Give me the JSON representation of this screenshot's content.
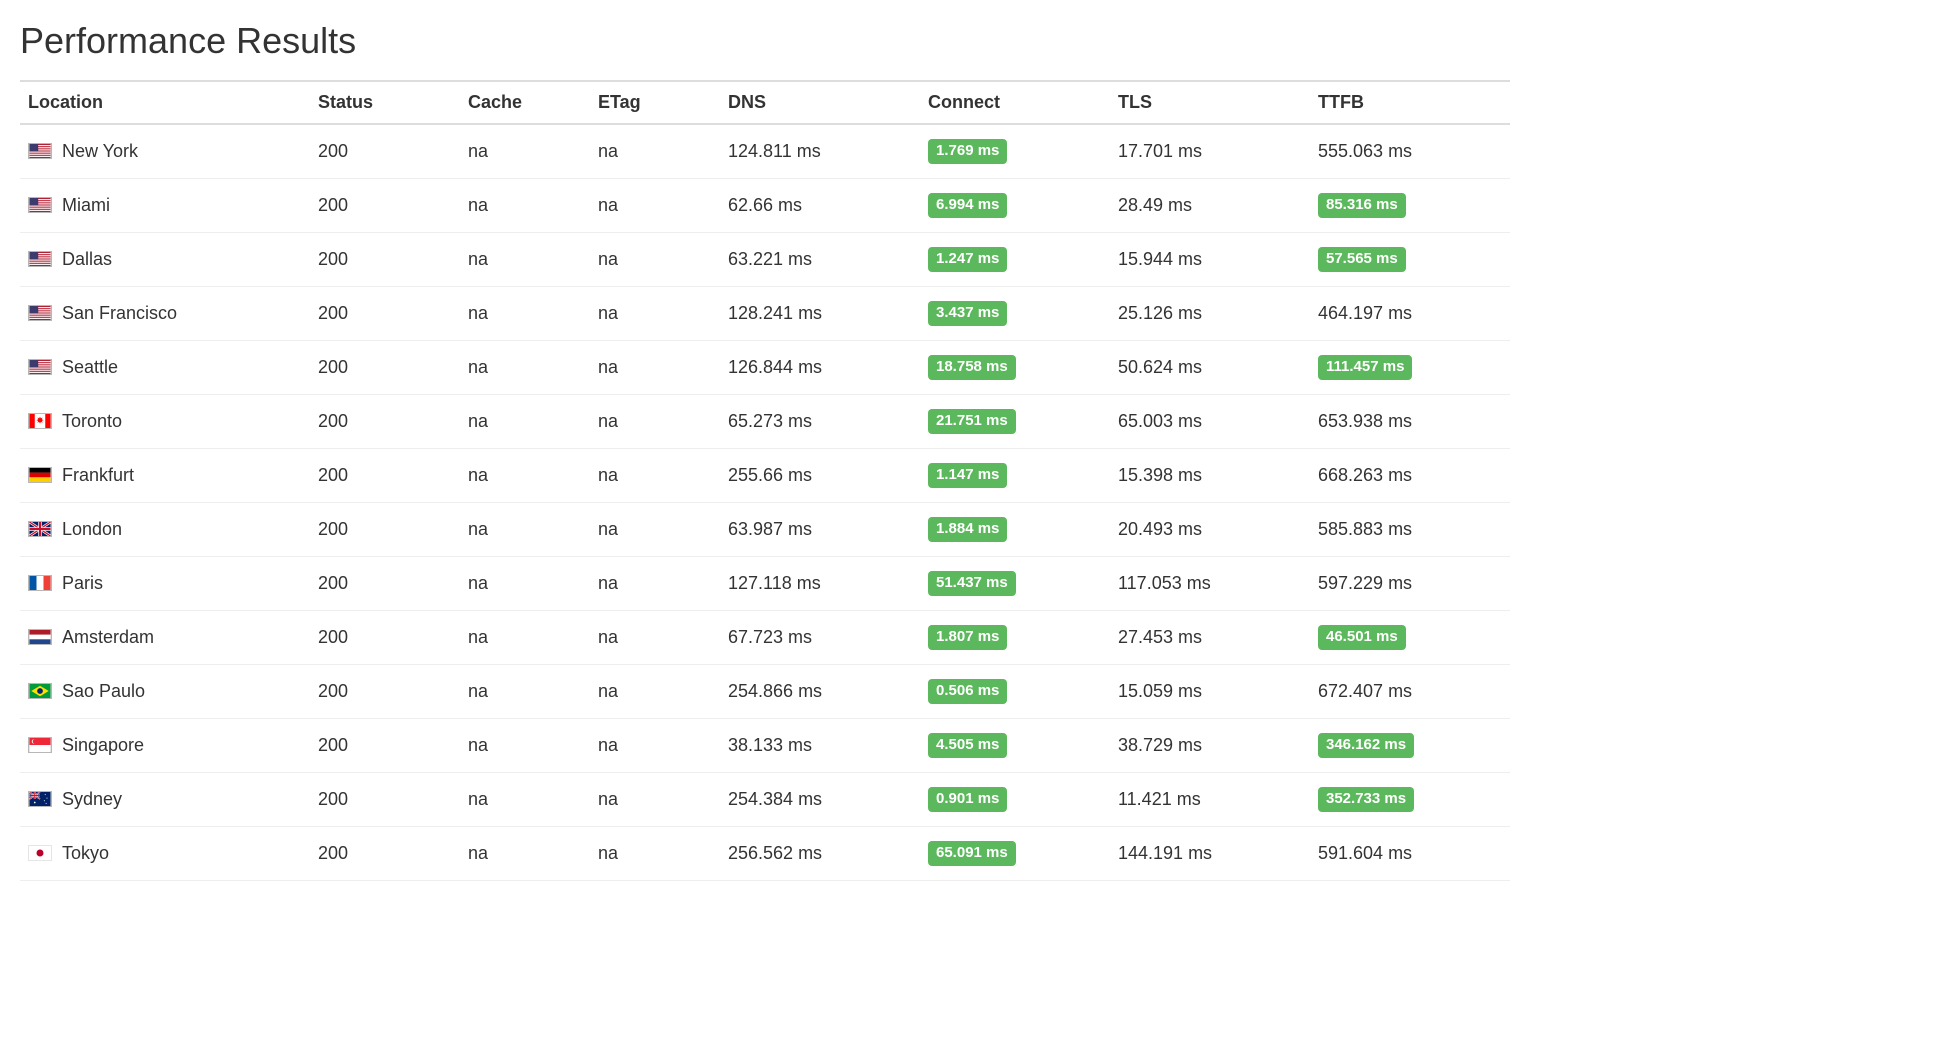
{
  "title": "Performance Results",
  "columns": {
    "location": "Location",
    "status": "Status",
    "cache": "Cache",
    "etag": "ETag",
    "dns": "DNS",
    "connect": "Connect",
    "tls": "TLS",
    "ttfb": "TTFB"
  },
  "rows": [
    {
      "flag": "us",
      "location": "New York",
      "status": "200",
      "cache": "na",
      "etag": "na",
      "dns": "124.811 ms",
      "connect": "1.769 ms",
      "connect_badge": true,
      "tls": "17.701 ms",
      "ttfb": "555.063 ms",
      "ttfb_badge": false
    },
    {
      "flag": "us",
      "location": "Miami",
      "status": "200",
      "cache": "na",
      "etag": "na",
      "dns": "62.66 ms",
      "connect": "6.994 ms",
      "connect_badge": true,
      "tls": "28.49 ms",
      "ttfb": "85.316 ms",
      "ttfb_badge": true
    },
    {
      "flag": "us",
      "location": "Dallas",
      "status": "200",
      "cache": "na",
      "etag": "na",
      "dns": "63.221 ms",
      "connect": "1.247 ms",
      "connect_badge": true,
      "tls": "15.944 ms",
      "ttfb": "57.565 ms",
      "ttfb_badge": true
    },
    {
      "flag": "us",
      "location": "San Francisco",
      "status": "200",
      "cache": "na",
      "etag": "na",
      "dns": "128.241 ms",
      "connect": "3.437 ms",
      "connect_badge": true,
      "tls": "25.126 ms",
      "ttfb": "464.197 ms",
      "ttfb_badge": false
    },
    {
      "flag": "us",
      "location": "Seattle",
      "status": "200",
      "cache": "na",
      "etag": "na",
      "dns": "126.844 ms",
      "connect": "18.758 ms",
      "connect_badge": true,
      "tls": "50.624 ms",
      "ttfb": "111.457 ms",
      "ttfb_badge": true
    },
    {
      "flag": "ca",
      "location": "Toronto",
      "status": "200",
      "cache": "na",
      "etag": "na",
      "dns": "65.273 ms",
      "connect": "21.751 ms",
      "connect_badge": true,
      "tls": "65.003 ms",
      "ttfb": "653.938 ms",
      "ttfb_badge": false
    },
    {
      "flag": "de",
      "location": "Frankfurt",
      "status": "200",
      "cache": "na",
      "etag": "na",
      "dns": "255.66 ms",
      "connect": "1.147 ms",
      "connect_badge": true,
      "tls": "15.398 ms",
      "ttfb": "668.263 ms",
      "ttfb_badge": false
    },
    {
      "flag": "gb",
      "location": "London",
      "status": "200",
      "cache": "na",
      "etag": "na",
      "dns": "63.987 ms",
      "connect": "1.884 ms",
      "connect_badge": true,
      "tls": "20.493 ms",
      "ttfb": "585.883 ms",
      "ttfb_badge": false
    },
    {
      "flag": "fr",
      "location": "Paris",
      "status": "200",
      "cache": "na",
      "etag": "na",
      "dns": "127.118 ms",
      "connect": "51.437 ms",
      "connect_badge": true,
      "tls": "117.053 ms",
      "ttfb": "597.229 ms",
      "ttfb_badge": false
    },
    {
      "flag": "nl",
      "location": "Amsterdam",
      "status": "200",
      "cache": "na",
      "etag": "na",
      "dns": "67.723 ms",
      "connect": "1.807 ms",
      "connect_badge": true,
      "tls": "27.453 ms",
      "ttfb": "46.501 ms",
      "ttfb_badge": true
    },
    {
      "flag": "br",
      "location": "Sao Paulo",
      "status": "200",
      "cache": "na",
      "etag": "na",
      "dns": "254.866 ms",
      "connect": "0.506 ms",
      "connect_badge": true,
      "tls": "15.059 ms",
      "ttfb": "672.407 ms",
      "ttfb_badge": false
    },
    {
      "flag": "sg",
      "location": "Singapore",
      "status": "200",
      "cache": "na",
      "etag": "na",
      "dns": "38.133 ms",
      "connect": "4.505 ms",
      "connect_badge": true,
      "tls": "38.729 ms",
      "ttfb": "346.162 ms",
      "ttfb_badge": true
    },
    {
      "flag": "au",
      "location": "Sydney",
      "status": "200",
      "cache": "na",
      "etag": "na",
      "dns": "254.384 ms",
      "connect": "0.901 ms",
      "connect_badge": true,
      "tls": "11.421 ms",
      "ttfb": "352.733 ms",
      "ttfb_badge": true
    },
    {
      "flag": "jp",
      "location": "Tokyo",
      "status": "200",
      "cache": "na",
      "etag": "na",
      "dns": "256.562 ms",
      "connect": "65.091 ms",
      "connect_badge": true,
      "tls": "144.191 ms",
      "ttfb": "591.604 ms",
      "ttfb_badge": false
    }
  ]
}
